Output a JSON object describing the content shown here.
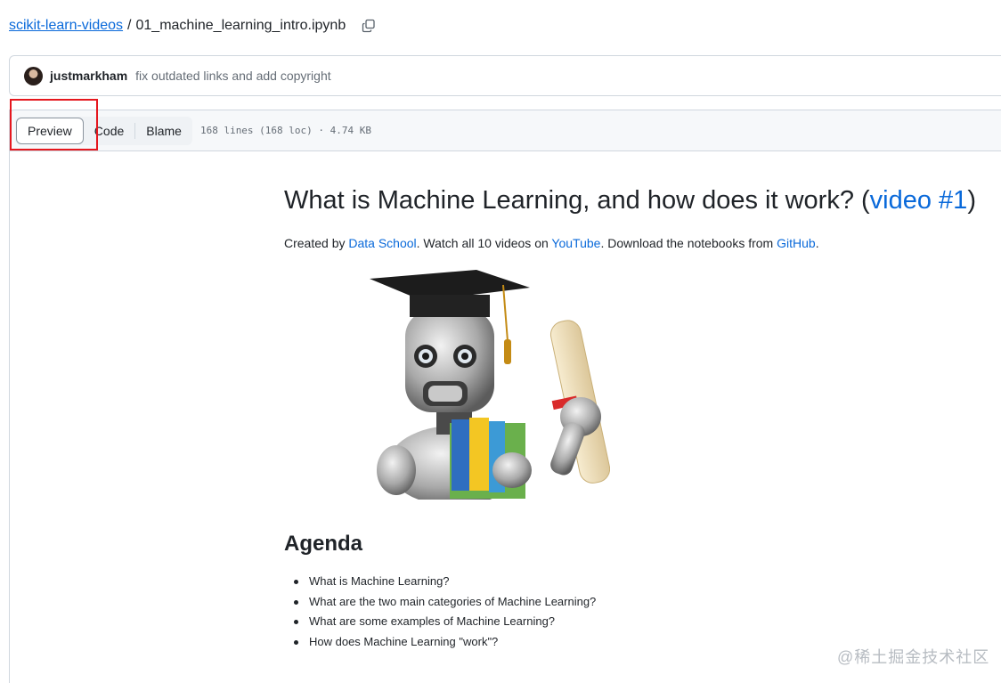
{
  "breadcrumb": {
    "repo": "scikit-learn-videos",
    "separator": "/",
    "file": "01_machine_learning_intro.ipynb"
  },
  "commit": {
    "author": "justmarkham",
    "message": "fix outdated links and add copyright"
  },
  "file_header": {
    "tabs": [
      "Preview",
      "Code",
      "Blame"
    ],
    "active_tab": "Preview",
    "meta": "168 lines (168 loc) · 4.74 KB"
  },
  "notebook": {
    "title_prefix": "What is Machine Learning, and how does it work? (",
    "title_link": "video #1",
    "title_suffix": ")",
    "intro": {
      "t1": "Created by ",
      "l1": "Data School",
      "t2": ". Watch all 10 videos on ",
      "l2": "YouTube",
      "t3": ". Download the notebooks from ",
      "l3": "GitHub",
      "t4": "."
    },
    "agenda_title": "Agenda",
    "agenda_items": [
      "What is Machine Learning?",
      "What are the two main categories of Machine Learning?",
      "What are some examples of Machine Learning?",
      "How does Machine Learning \"work\"?"
    ]
  },
  "watermark": "@稀土掘金技术社区",
  "colors": {
    "link": "#0969da",
    "highlight": "#e5171e",
    "border": "#d0d7de"
  }
}
